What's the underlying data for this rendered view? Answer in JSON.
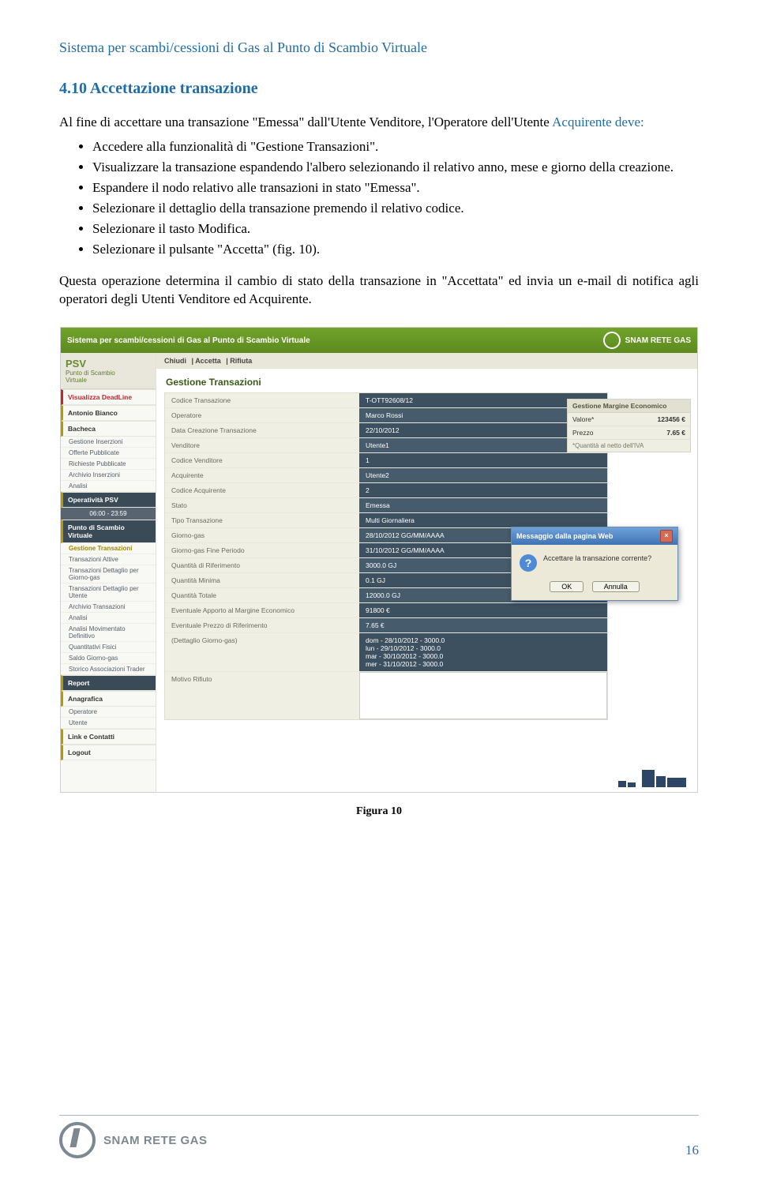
{
  "doc": {
    "header": "Sistema per scambi/cessioni di Gas al Punto di Scambio Virtuale",
    "section_number": "4.10",
    "section_title": "Accettazione transazione",
    "intro_1": "Al fine di accettare una transazione \"Emessa\" dall'Utente Venditore, l'Operatore dell'Utente ",
    "intro_link": "Acquirente deve:",
    "bullets": [
      "Accedere alla funzionalità di \"Gestione Transazioni\".",
      "Visualizzare la transazione espandendo l'albero selezionando il relativo anno, mese e giorno della creazione.",
      "Espandere il nodo relativo alle transazioni in stato \"Emessa\".",
      "Selezionare il dettaglio della transazione premendo il relativo codice.",
      "Selezionare il tasto Modifica.",
      "Selezionare il pulsante \"Accetta\" (fig. 10)."
    ],
    "outro": "Questa operazione determina il cambio di stato della transazione in \"Accettata\" ed invia un e-mail di notifica agli operatori degli Utenti Venditore ed Acquirente.",
    "figure_caption": "Figura 10",
    "footer_brand": "SNAM RETE GAS",
    "page_number": "16"
  },
  "shot": {
    "top_title": "Sistema per scambi/cessioni di Gas al Punto di Scambio Virtuale",
    "brand": "SNAM RETE GAS",
    "psv": {
      "abbr": "PSV",
      "line1": "Punto di Scambio",
      "line2": "Virtuale"
    },
    "cmdbar": {
      "a": "Chiudi",
      "b": "Accetta",
      "c": "Rifiuta"
    },
    "page_title": "Gestione Transazioni",
    "sidebar": {
      "deadline": "Visualizza DeadLine",
      "user": "Antonio Bianco",
      "bacheca": "Bacheca",
      "bacheca_items": [
        "Gestione Inserzioni",
        "Offerte Pubblicate",
        "Richieste Pubblicate",
        "Archivio Inserzioni",
        "Analisi"
      ],
      "op_hdr": "Operatività PSV",
      "op_time": "06:00 - 23:59",
      "psv_hdr": "Punto di Scambio Virtuale",
      "psv_items": [
        "Gestione Transazioni",
        "Transazioni Attive",
        "Transazioni Dettaglio per Giorno-gas",
        "Transazioni Dettaglio per Utente",
        "Archivio Transazioni",
        "Analisi",
        "Analisi Movimentato Definitivo",
        "Quantitativi Fisici",
        "Saldo Giorno-gas",
        "Storico Associazioni Trader"
      ],
      "report": "Report",
      "anag": "Anagrafica",
      "anag_items": [
        "Operatore",
        "Utente"
      ],
      "links": "Link e Contatti",
      "logout": "Logout"
    },
    "details": [
      {
        "k": "Codice Transazione",
        "v": "T-OTT92608/12"
      },
      {
        "k": "Operatore",
        "v": "Marco Rossi"
      },
      {
        "k": "Data Creazione Transazione",
        "v": "22/10/2012"
      },
      {
        "k": "Venditore",
        "v": "Utente1"
      },
      {
        "k": "Codice Venditore",
        "v": "1"
      },
      {
        "k": "Acquirente",
        "v": "Utente2"
      },
      {
        "k": "Codice Acquirente",
        "v": "2"
      },
      {
        "k": "Stato",
        "v": "Emessa"
      },
      {
        "k": "Tipo Transazione",
        "v": "Multi Giornaliera"
      },
      {
        "k": "Giorno-gas",
        "v": "28/10/2012 GG/MM/AAAA"
      },
      {
        "k": "Giorno-gas Fine Periodo",
        "v": "31/10/2012 GG/MM/AAAA"
      },
      {
        "k": "Quantità di Riferimento",
        "v": "3000.0 GJ"
      },
      {
        "k": "Quantità Minima",
        "v": "0.1 GJ"
      },
      {
        "k": "Quantità Totale",
        "v": "12000.0 GJ"
      },
      {
        "k": "Eventuale Apporto al Margine Economico",
        "v": "91800 €"
      },
      {
        "k": "Eventuale Prezzo di Riferimento",
        "v": "7.65 €"
      },
      {
        "k": "(Dettaglio Giorno-gas)",
        "v": "dom - 28/10/2012 - 3000.0\nlun - 29/10/2012 - 3000.0\nmar - 30/10/2012 - 3000.0\nmer - 31/10/2012 - 3000.0"
      }
    ],
    "motivo_label": "Motivo Rifiuto",
    "margin": {
      "title": "Gestione Margine Economico",
      "r1k": "Valore*",
      "r1v": "123456 €",
      "r2k": "Prezzo",
      "r2v": "7.65 €",
      "note": "*Quantità al netto dell'IVA"
    },
    "modal": {
      "title": "Messaggio dalla pagina Web",
      "text": "Accettare la transazione corrente?",
      "ok": "OK",
      "cancel": "Annulla"
    }
  }
}
